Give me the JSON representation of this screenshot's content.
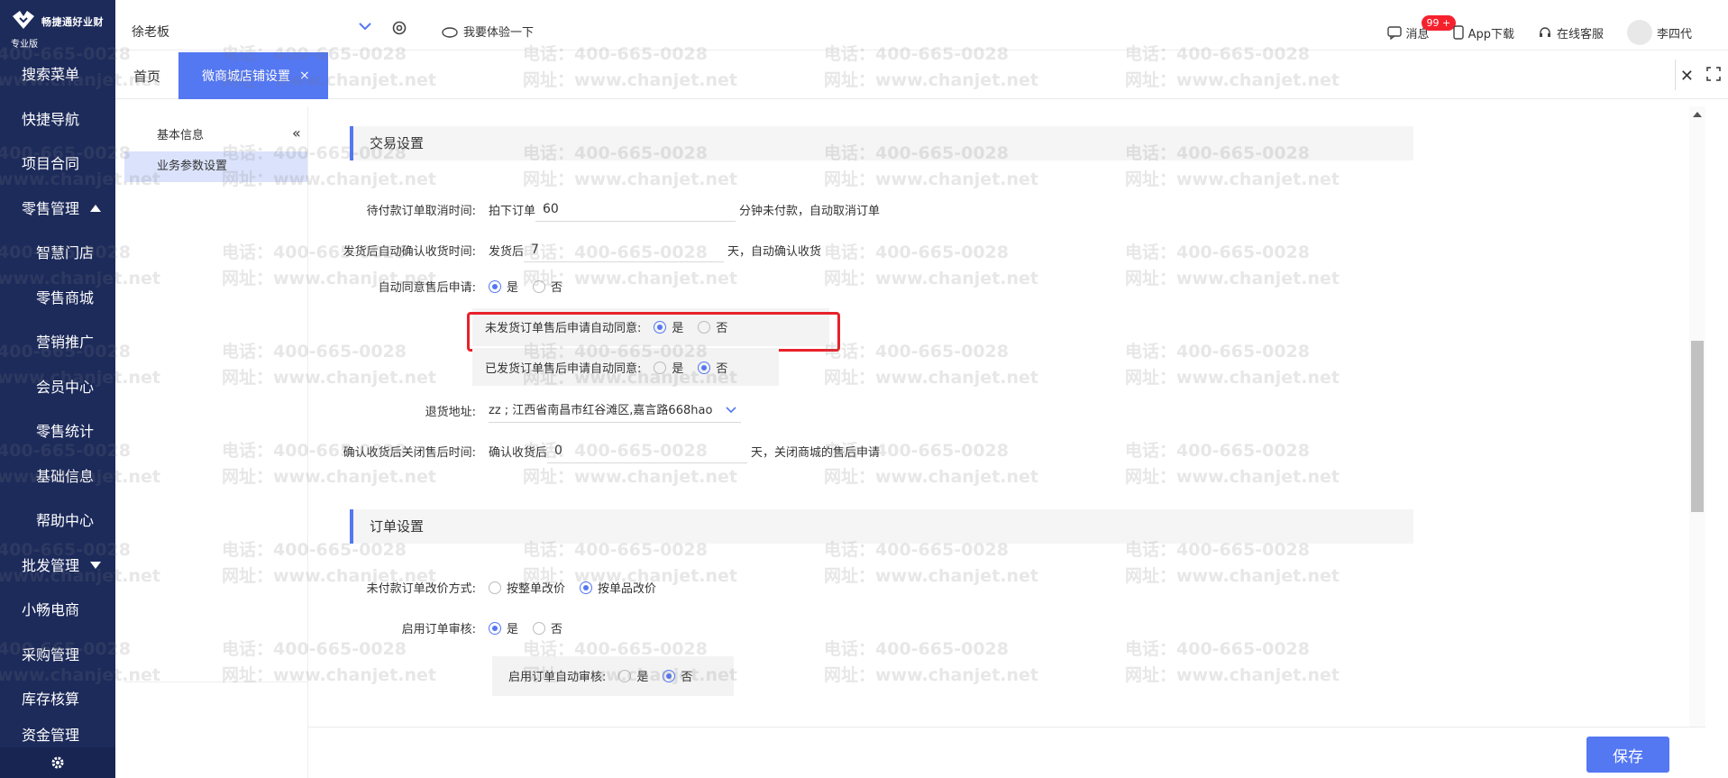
{
  "sidebar": {
    "logo_text": "畅捷通好业财",
    "edition": "专业版",
    "items": [
      {
        "label": "搜索菜单",
        "kind": "top"
      },
      {
        "label": "快捷导航",
        "kind": "top"
      },
      {
        "label": "项目合同",
        "kind": "top"
      },
      {
        "label": "零售管理",
        "kind": "top",
        "caret": "up"
      },
      {
        "label": "智慧门店",
        "kind": "sub"
      },
      {
        "label": "零售商城",
        "kind": "sub"
      },
      {
        "label": "营销推广",
        "kind": "sub"
      },
      {
        "label": "会员中心",
        "kind": "sub"
      },
      {
        "label": "零售统计",
        "kind": "sub"
      },
      {
        "label": "基础信息",
        "kind": "sub"
      },
      {
        "label": "帮助中心",
        "kind": "sub"
      },
      {
        "label": "批发管理",
        "kind": "top",
        "caret": "down"
      },
      {
        "label": "小畅电商",
        "kind": "top"
      },
      {
        "label": "采购管理",
        "kind": "top"
      },
      {
        "label": "库存核算",
        "kind": "top"
      },
      {
        "label": "资金管理",
        "kind": "top"
      }
    ]
  },
  "topbar": {
    "tenant": "徐老板",
    "try_label": "我要体验一下",
    "messages_label": "消息",
    "messages_badge": "99 +",
    "app_download": "App下载",
    "online_service": "在线客服",
    "user_name": "李四代"
  },
  "tabs": {
    "home": "首页",
    "active": "微商城店铺设置",
    "active_close": "×",
    "close_all": "✕"
  },
  "subnav": {
    "items": [
      "基本信息",
      "业务参数设置"
    ],
    "active_index": 1
  },
  "trade_section": {
    "title": "交易设置",
    "unpaid_cancel": {
      "label": "待付款订单取消时间:",
      "prefix": "拍下订单",
      "value": "60",
      "suffix": "分钟未付款，自动取消订单"
    },
    "auto_confirm": {
      "label": "发货后自动确认收货时间:",
      "prefix": "发货后",
      "value": "7",
      "suffix": "天，自动确认收货"
    },
    "auto_agree": {
      "label": "自动同意售后申请:",
      "yes": "是",
      "no": "否",
      "selected": "yes"
    },
    "unshipped_agree": {
      "label": "未发货订单售后申请自动同意:",
      "yes": "是",
      "no": "否",
      "selected": "yes"
    },
    "shipped_agree": {
      "label": "已发货订单售后申请自动同意:",
      "yes": "是",
      "no": "否",
      "selected": "no"
    },
    "return_address": {
      "label": "退货地址:",
      "value": "zz ; 江西省南昌市红谷滩区,嘉言路668hao"
    },
    "close_after_confirm": {
      "label": "确认收货后关闭售后时间:",
      "prefix": "确认收货后",
      "value": "0",
      "suffix": "天，关闭商城的售后申请"
    }
  },
  "order_section": {
    "title": "订单设置",
    "price_change": {
      "label": "未付款订单改价方式:",
      "opt1": "按整单改价",
      "opt2": "按单品改价",
      "selected": "opt2"
    },
    "enable_audit": {
      "label": "启用订单审核:",
      "yes": "是",
      "no": "否",
      "selected": "yes"
    },
    "auto_audit": {
      "label": "启用订单自动审核:",
      "yes": "是",
      "no": "否",
      "selected": "no"
    }
  },
  "footer": {
    "save": "保存"
  },
  "watermark": {
    "phone": "电话：400-665-0028",
    "site": "网址：www.chanjet.net"
  },
  "colors": {
    "sidebar": "#1d2b5b",
    "accent": "#5477f2",
    "highlight": "#e8212a"
  }
}
